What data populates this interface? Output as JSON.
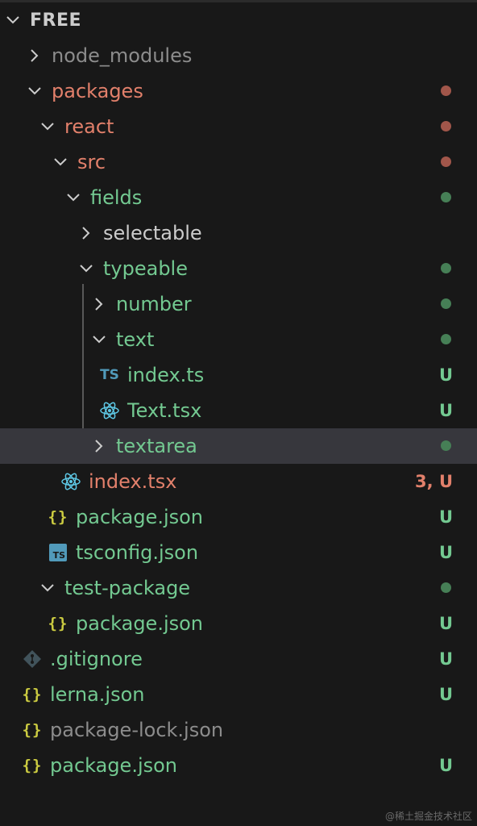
{
  "header": {
    "title": "FREE"
  },
  "colors": {
    "background": "#181818",
    "selected": "#37373d",
    "green": "#73c991",
    "red": "#e2806b",
    "gray": "#8c8c8c",
    "white": "#cccccc",
    "dot_green": "#467f56",
    "dot_red": "#a1564a"
  },
  "tree": [
    {
      "label": "node_modules",
      "kind": "folder",
      "expanded": false,
      "color": "gray",
      "status": "",
      "dot": ""
    },
    {
      "label": "packages",
      "kind": "folder",
      "expanded": true,
      "color": "red",
      "status": "",
      "dot": "red"
    },
    {
      "label": "react",
      "kind": "folder",
      "expanded": true,
      "color": "red",
      "status": "",
      "dot": "red"
    },
    {
      "label": "src",
      "kind": "folder",
      "expanded": true,
      "color": "red",
      "status": "",
      "dot": "red"
    },
    {
      "label": "fields",
      "kind": "folder",
      "expanded": true,
      "color": "green",
      "status": "",
      "dot": "green"
    },
    {
      "label": "selectable",
      "kind": "folder",
      "expanded": false,
      "color": "white",
      "status": "",
      "dot": ""
    },
    {
      "label": "typeable",
      "kind": "folder",
      "expanded": true,
      "color": "green",
      "status": "",
      "dot": "green"
    },
    {
      "label": "number",
      "kind": "folder",
      "expanded": false,
      "color": "green",
      "status": "",
      "dot": "green"
    },
    {
      "label": "text",
      "kind": "folder",
      "expanded": true,
      "color": "green",
      "status": "",
      "dot": "green"
    },
    {
      "label": "index.ts",
      "kind": "ts-icon",
      "color": "green",
      "status": "U",
      "dot": ""
    },
    {
      "label": "Text.tsx",
      "kind": "react-icon",
      "color": "green",
      "status": "U",
      "dot": ""
    },
    {
      "label": "textarea",
      "kind": "folder",
      "expanded": false,
      "color": "green",
      "status": "",
      "dot": "green",
      "selected": true
    },
    {
      "label": "index.tsx",
      "kind": "react-icon",
      "color": "red",
      "status": "3, U",
      "dot": ""
    },
    {
      "label": "package.json",
      "kind": "json-icon",
      "color": "green",
      "status": "U",
      "dot": ""
    },
    {
      "label": "tsconfig.json",
      "kind": "tsconfig-icon",
      "color": "green",
      "status": "U",
      "dot": ""
    },
    {
      "label": "test-package",
      "kind": "folder",
      "expanded": true,
      "color": "green",
      "status": "",
      "dot": "green"
    },
    {
      "label": "package.json",
      "kind": "json-icon",
      "color": "green",
      "status": "U",
      "dot": ""
    },
    {
      "label": ".gitignore",
      "kind": "git-icon",
      "color": "green",
      "status": "U",
      "dot": ""
    },
    {
      "label": "lerna.json",
      "kind": "json-icon",
      "color": "green",
      "status": "U",
      "dot": ""
    },
    {
      "label": "package-lock.json",
      "kind": "json-icon",
      "color": "gray",
      "status": "",
      "dot": ""
    },
    {
      "label": "package.json",
      "kind": "json-icon",
      "color": "green",
      "status": "U",
      "dot": ""
    }
  ],
  "icons": {
    "ts_label": "TS",
    "json_label": "{}",
    "tsconfig_label": "TS"
  },
  "watermark": "@稀土掘金技术社区"
}
